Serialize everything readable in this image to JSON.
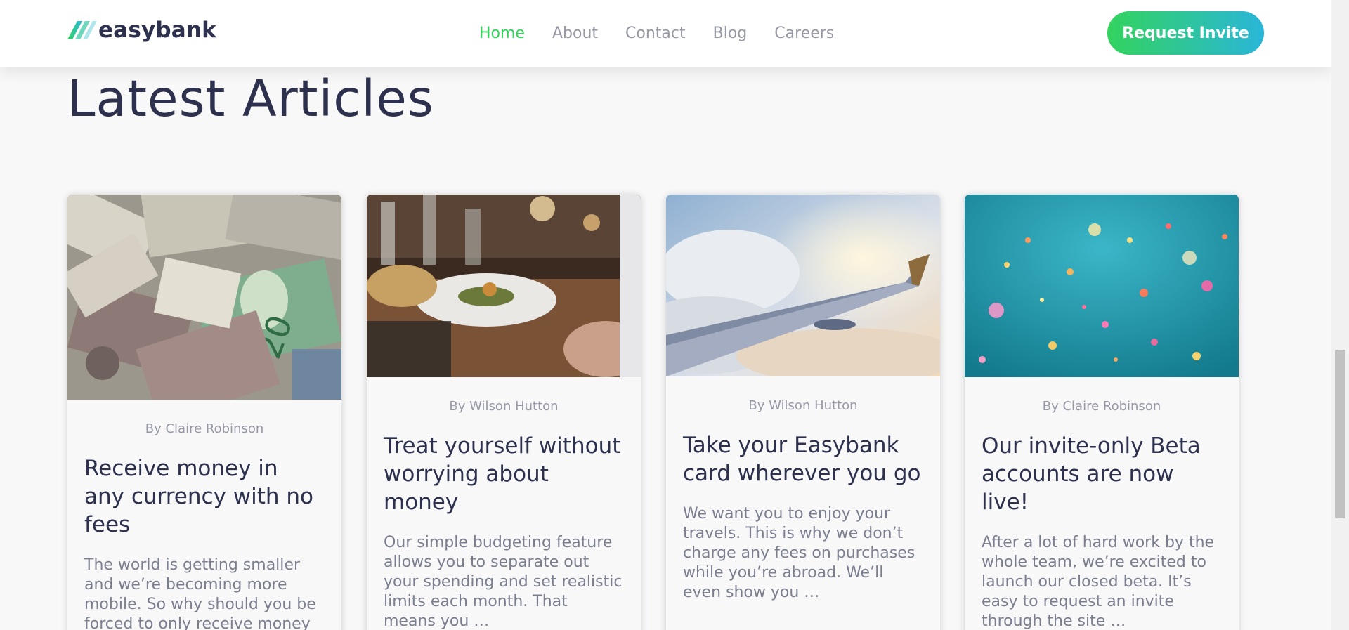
{
  "brand": {
    "name": "easybank"
  },
  "nav": {
    "items": [
      {
        "label": "Home"
      },
      {
        "label": "About"
      },
      {
        "label": "Contact"
      },
      {
        "label": "Blog"
      },
      {
        "label": "Careers"
      }
    ],
    "active": "Home",
    "cta_label": "Request Invite"
  },
  "section": {
    "title": "Latest Articles"
  },
  "articles": [
    {
      "author": "By Claire Robinson",
      "title": "Receive money in any currency with no fees",
      "excerpt": "The world is getting smaller and we’re becoming more mobile. So why should you be forced to only receive money in a single …",
      "image": "currency-photo"
    },
    {
      "author": "By Wilson Hutton",
      "title": "Treat yourself without worrying about money",
      "excerpt": "Our simple budgeting feature allows you to separate out your spending and set realistic limits each month. That means you …",
      "image": "restaurant-photo"
    },
    {
      "author": "By Wilson Hutton",
      "title": "Take your Easybank card wherever you go",
      "excerpt": "We want you to enjoy your travels. This is why we don’t charge any fees on purchases while you’re abroad. We’ll even show you …",
      "image": "plane-photo"
    },
    {
      "author": "By Claire Robinson",
      "title": "Our invite-only Beta accounts are now live!",
      "excerpt": "After a lot of hard work by the whole team, we’re excited to launch our closed beta. It’s easy to request an invite through the site …",
      "image": "confetti-photo"
    }
  ],
  "colors": {
    "brand_dark": "#2d314d",
    "accent_green": "#31d35c",
    "accent_cyan": "#2ab6d9",
    "grey_text": "#9698a6",
    "background": "#f8f8f9"
  },
  "icons": [
    "easybank-logo-icon"
  ]
}
